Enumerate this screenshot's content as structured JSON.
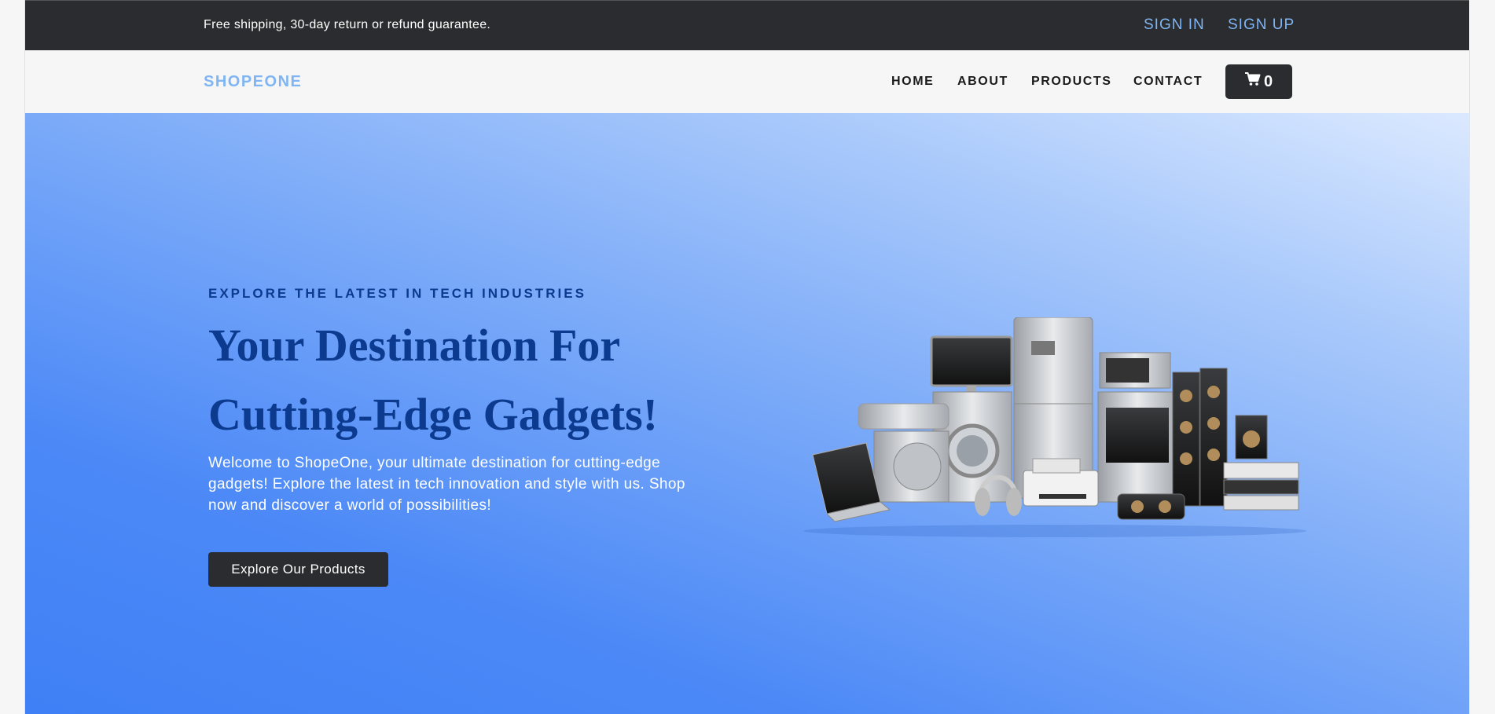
{
  "topbar": {
    "promo": "Free shipping, 30-day return or refund guarantee.",
    "sign_in": "SIGN IN",
    "sign_up": "SIGN UP"
  },
  "nav": {
    "brand": "SHOPEONE",
    "links": [
      "HOME",
      "ABOUT",
      "PRODUCTS",
      "CONTACT"
    ],
    "cart_count": "0"
  },
  "hero": {
    "eyebrow": "EXPLORE THE LATEST IN TECH INDUSTRIES",
    "headline": "Your Destination For Cutting-Edge Gadgets!",
    "intro": "Welcome to ShopeOne, your ultimate destination for cutting-edge gadgets! Explore the latest in tech innovation and style with us. Shop now and discover a world of possibilities!",
    "cta": "Explore Our Products"
  },
  "colors": {
    "dark": "#2b2c2f",
    "accent": "#7fb5f2",
    "headline": "#0b3a8f",
    "hero_blue": "#3f80f6"
  },
  "icons": {
    "cart": "shopping-cart-icon"
  }
}
